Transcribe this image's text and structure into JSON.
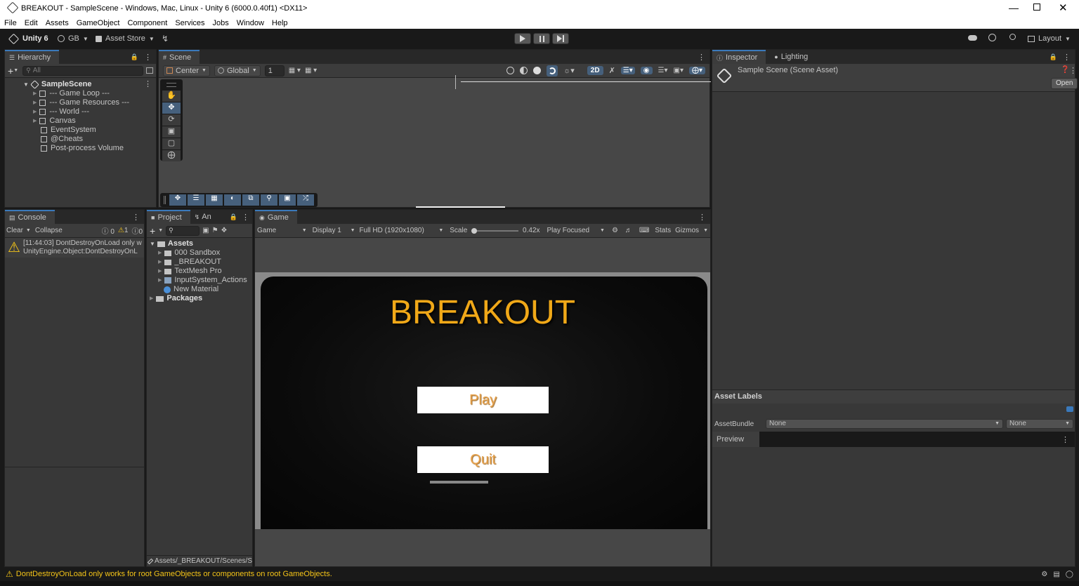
{
  "window": {
    "title": "BREAKOUT - SampleScene - Windows, Mac, Linux - Unity 6 (6000.0.40f1) <DX11>"
  },
  "menu": [
    "File",
    "Edit",
    "Assets",
    "GameObject",
    "Component",
    "Services",
    "Jobs",
    "Window",
    "Help"
  ],
  "toolbar": {
    "app": "Unity 6",
    "account": "GB",
    "asset_store": "Asset Store",
    "layout": "Layout"
  },
  "hierarchy": {
    "tab": "Hierarchy",
    "search_placeholder": "All",
    "scene": "SampleScene",
    "items": [
      "--- Game Loop ---",
      "--- Game Resources ---",
      "--- World ---",
      "Canvas",
      "EventSystem",
      "@Cheats",
      "Post-process Volume"
    ]
  },
  "scene_view": {
    "tab": "Scene",
    "pivot": "Center",
    "space": "Global",
    "grid_value": "1",
    "mode_2d": "2D"
  },
  "inspector": {
    "tab": "Inspector",
    "lighting_tab": "Lighting",
    "asset_title": "Sample Scene (Scene Asset)",
    "open_button": "Open",
    "asset_labels": "Asset Labels",
    "assetbundle_label": "AssetBundle",
    "assetbundle_value": "None",
    "variant_value": "None",
    "preview": "Preview"
  },
  "console": {
    "tab": "Console",
    "clear": "Clear",
    "collapse": "Collapse",
    "counts": {
      "info": "0",
      "warn": "1",
      "error": "0"
    },
    "message_line1": "[11:44:03] DontDestroyOnLoad only w",
    "message_line2": "UnityEngine.Object:DontDestroyOnL"
  },
  "project": {
    "tab": "Project",
    "anim_tab": "An",
    "root": "Assets",
    "items": [
      "000 Sandbox",
      "_BREAKOUT",
      "TextMesh Pro",
      "InputSystem_Actions",
      "New Material"
    ],
    "packages": "Packages",
    "path": "Assets/_BREAKOUT/Scenes/S"
  },
  "game_view": {
    "tab": "Game",
    "mode": "Game",
    "display": "Display 1",
    "resolution": "Full HD (1920x1080)",
    "scale_label": "Scale",
    "scale_value": "0.42x",
    "play_focus": "Play Focused",
    "stats": "Stats",
    "gizmos": "Gizmos",
    "game_title": "BREAKOUT",
    "play_button": "Play",
    "quit_button": "Quit"
  },
  "status_bar": {
    "message": "DontDestroyOnLoad only works for root GameObjects or components on root GameObjects."
  },
  "colors": {
    "accent": "#3a79bb",
    "breakout_title": "#f0a818",
    "button_text": "#e8a24c",
    "warning": "#f5c518"
  }
}
